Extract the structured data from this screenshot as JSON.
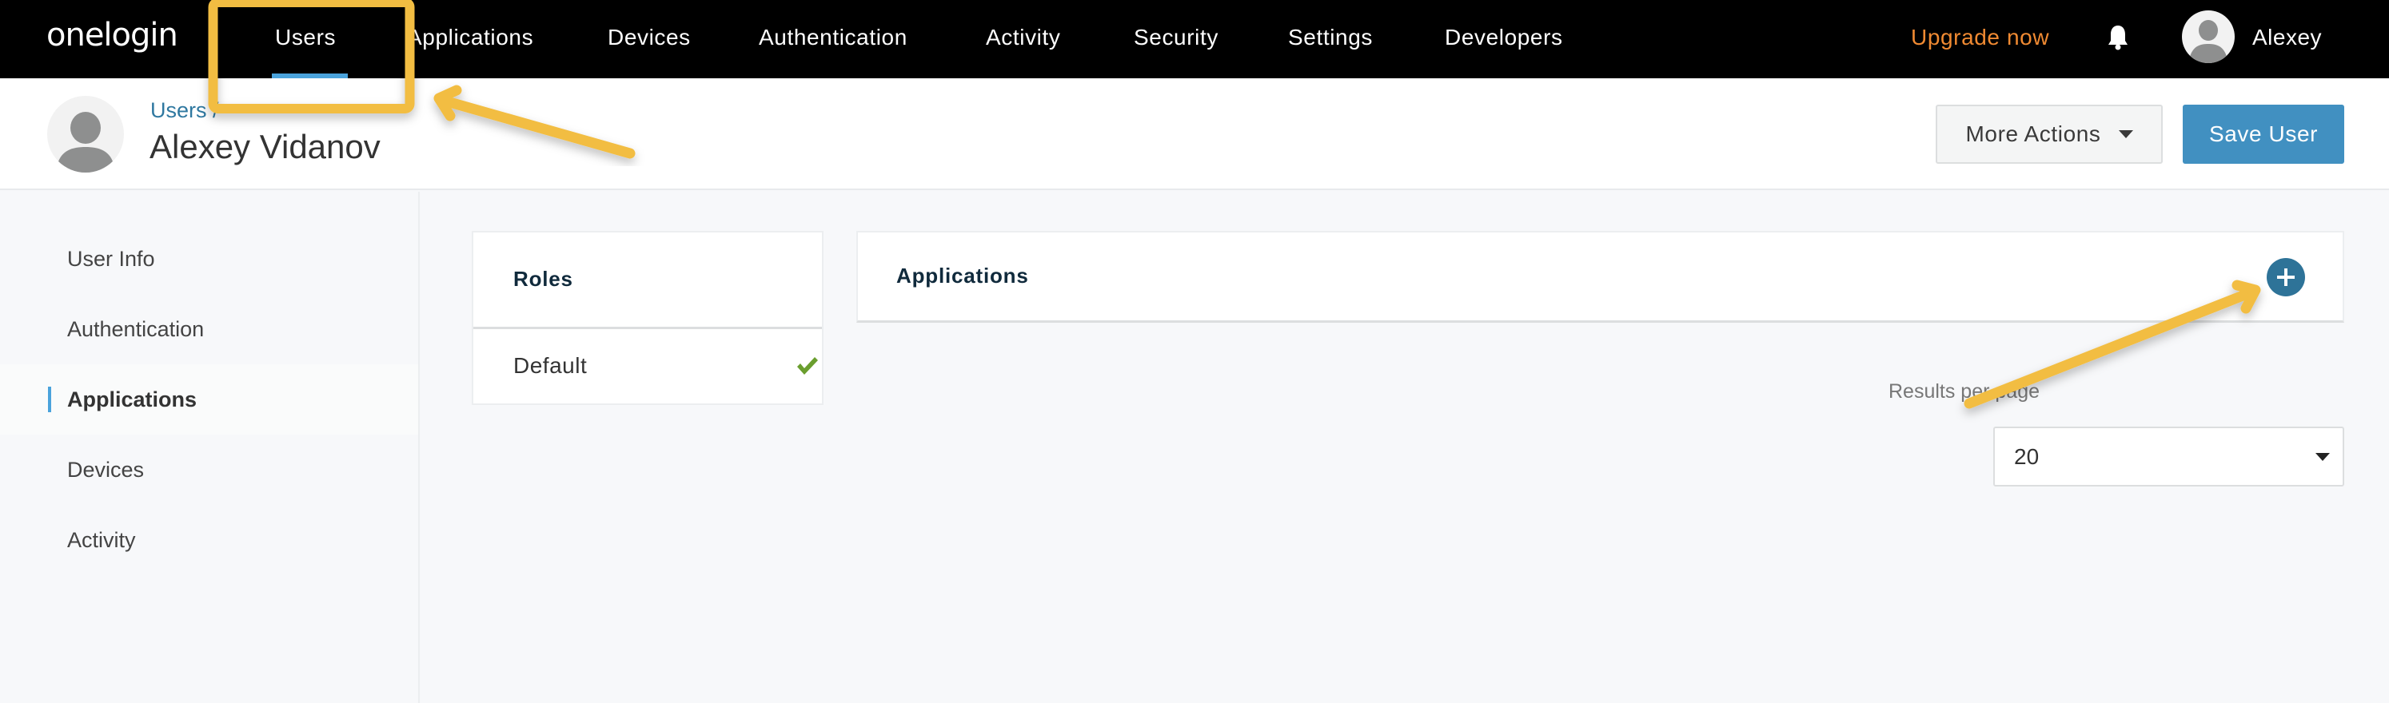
{
  "topnav": {
    "logo": "onelogin",
    "items": [
      {
        "label": "Users",
        "active": true
      },
      {
        "label": "Applications"
      },
      {
        "label": "Devices"
      },
      {
        "label": "Authentication"
      },
      {
        "label": "Activity"
      },
      {
        "label": "Security"
      },
      {
        "label": "Settings"
      },
      {
        "label": "Developers"
      }
    ],
    "upgrade_label": "Upgrade now",
    "notifications_icon": "bell-icon",
    "username": "Alexey"
  },
  "header": {
    "breadcrumb": "Users /",
    "title": "Alexey Vidanov",
    "more_actions_label": "More Actions",
    "save_label": "Save User"
  },
  "sidebar": {
    "items": [
      {
        "label": "User Info"
      },
      {
        "label": "Authentication"
      },
      {
        "label": "Applications",
        "active": true
      },
      {
        "label": "Devices"
      },
      {
        "label": "Activity"
      }
    ]
  },
  "roles": {
    "title": "Roles",
    "items": [
      {
        "label": "Default",
        "assigned": true
      }
    ]
  },
  "applications": {
    "title": "Applications",
    "add_icon": "plus-circle-icon"
  },
  "pagination": {
    "results_per_page_label": "Results per page",
    "results_per_page_value": "20"
  },
  "colors": {
    "nav_bg": "#000000",
    "active_underline": "#4aa3dc",
    "upgrade": "#f08a32",
    "primary_button": "#4190c1",
    "add_button": "#2e7398",
    "breadcrumb_link": "#2f78a0",
    "check": "#6a9e2e",
    "annotation": "#f2bd42"
  }
}
